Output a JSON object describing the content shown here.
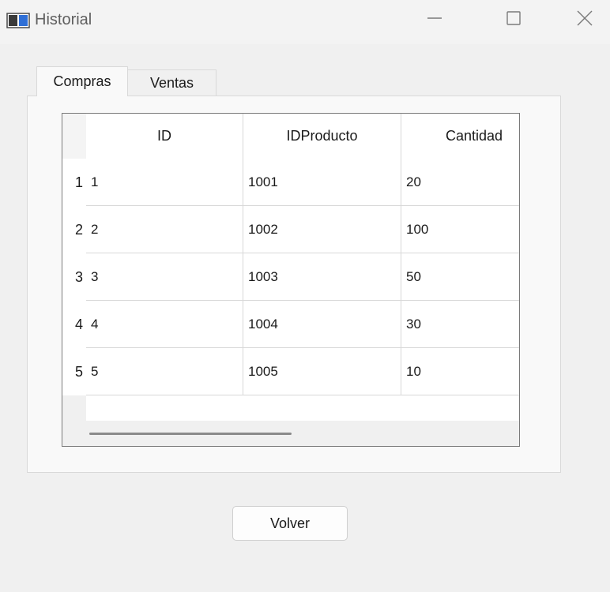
{
  "window": {
    "title": "Historial",
    "icon": "app-window-icon",
    "controls": [
      "minimize-icon",
      "maximize-icon",
      "close-icon"
    ]
  },
  "tabs": [
    {
      "label": "Compras",
      "active": true
    },
    {
      "label": "Ventas",
      "active": false
    }
  ],
  "table": {
    "columns": [
      "ID",
      "IDProducto",
      "Cantidad"
    ],
    "rows": [
      {
        "row_label": "1",
        "cells": [
          "1",
          "1001",
          "20"
        ]
      },
      {
        "row_label": "2",
        "cells": [
          "2",
          "1002",
          "100"
        ]
      },
      {
        "row_label": "3",
        "cells": [
          "3",
          "1003",
          "50"
        ]
      },
      {
        "row_label": "4",
        "cells": [
          "4",
          "1004",
          "30"
        ]
      },
      {
        "row_label": "5",
        "cells": [
          "5",
          "1005",
          "10"
        ]
      }
    ]
  },
  "actions": {
    "back_label": "Volver"
  },
  "colors": {
    "window_bg": "#f0f0f0",
    "pane_bg": "#f9f9f9",
    "grid_line": "#d8d8d8",
    "table_border": "#7a7a7a"
  }
}
